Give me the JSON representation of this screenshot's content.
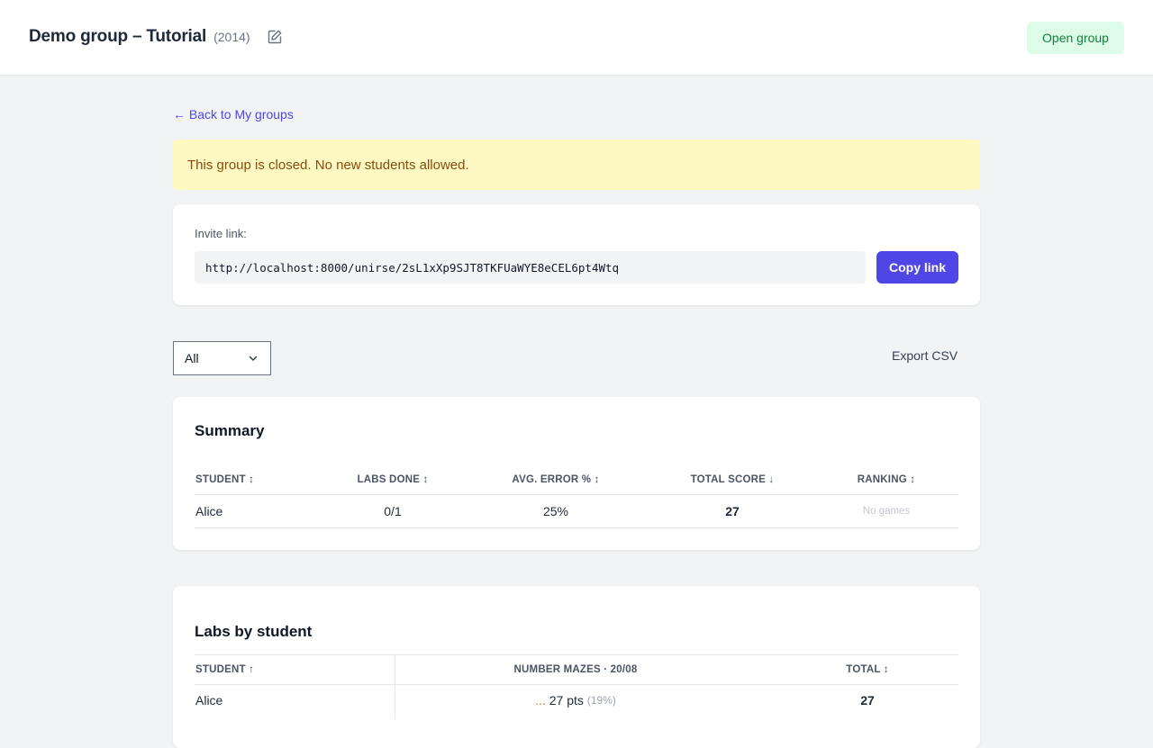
{
  "header": {
    "title": "Demo group – Tutorial",
    "year": "(2014)",
    "open_group_label": "Open group"
  },
  "nav": {
    "back_label": "← Back to My groups"
  },
  "notice": {
    "text": "This group is closed. No new students allowed."
  },
  "invite": {
    "label": "Invite link:",
    "url": "http://localhost:8000/unirse/2sL1xXp9SJT8TKFUaWYE8eCEL6pt4Wtq",
    "copy_label": "Copy link"
  },
  "filter": {
    "selected": "All"
  },
  "export_label": "Export CSV",
  "summary": {
    "title": "Summary",
    "columns": [
      "STUDENT ↕",
      "LABS DONE ↕",
      "AVG. ERROR % ↕",
      "TOTAL SCORE ↓",
      "RANKING ↕"
    ],
    "rows": [
      {
        "student": "Alice",
        "labs_done": "0/1",
        "avg_error": "25%",
        "total_score": "27",
        "ranking": "No games"
      }
    ]
  },
  "labs": {
    "title": "Labs by student",
    "columns": [
      "STUDENT ↑",
      "NUMBER MAZES · 20/08",
      "TOTAL ↕"
    ],
    "rows": [
      {
        "student": "Alice",
        "prefix": "...",
        "points": "27 pts",
        "percent": "(19%)",
        "total": "27"
      }
    ]
  },
  "colors": {
    "accent": "#4f46e5",
    "open_bg": "#dcfce7",
    "open_text": "#15803d",
    "notice_bg": "#fef9c3",
    "notice_text": "#854d0e"
  }
}
